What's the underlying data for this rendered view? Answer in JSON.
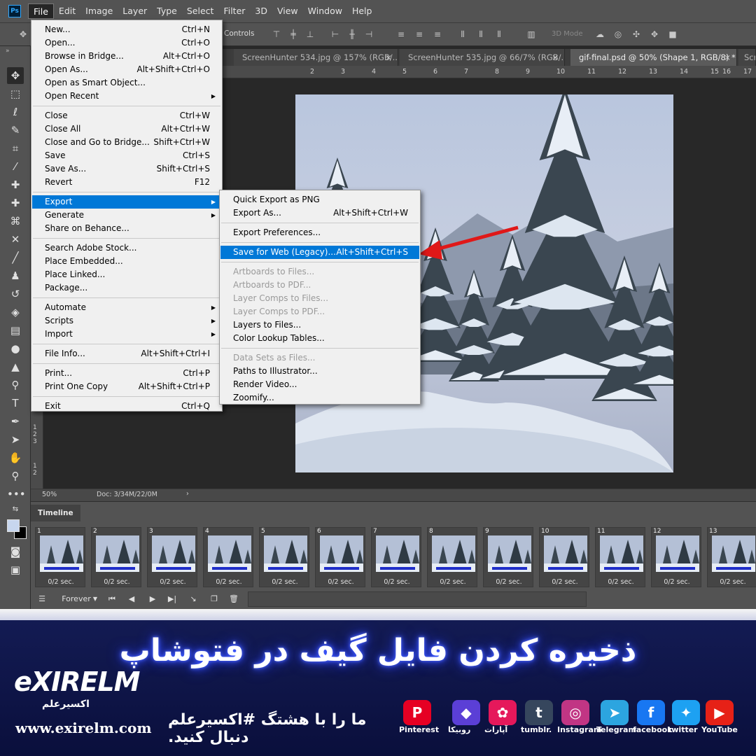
{
  "menubar": {
    "logo": "Ps",
    "items": [
      "File",
      "Edit",
      "Image",
      "Layer",
      "Type",
      "Select",
      "Filter",
      "3D",
      "View",
      "Window",
      "Help"
    ]
  },
  "options_bar": {
    "controls_label": "Controls",
    "mode3d_label": "3D Mode"
  },
  "tabs": [
    {
      "title": "ScreenHunter 534.jpg @ 157% (RGB/...",
      "close": "×"
    },
    {
      "title": "ScreenHunter 535.jpg @ 66/7% (RGB/...",
      "close": "×"
    },
    {
      "title": "gif-final.psd @ 50% (Shape 1, RGB/8) *",
      "close": "×"
    },
    {
      "title": "Scr",
      "close": ""
    }
  ],
  "ruler_top": [
    "2",
    "3",
    "4",
    "5",
    "6",
    "7",
    "8",
    "9",
    "10",
    "11",
    "12",
    "13",
    "14",
    "15",
    "16",
    "17"
  ],
  "ruler_left": [
    "1",
    "2",
    "3",
    "1",
    "2"
  ],
  "status": {
    "zoom": "50%",
    "doc": "Doc: 3/34M/22/0M"
  },
  "file_menu": {
    "groups": [
      [
        {
          "label": "New...",
          "shortcut": "Ctrl+N"
        },
        {
          "label": "Open...",
          "shortcut": "Ctrl+O"
        },
        {
          "label": "Browse in Bridge...",
          "shortcut": "Alt+Ctrl+O"
        },
        {
          "label": "Open As...",
          "shortcut": "Alt+Shift+Ctrl+O"
        },
        {
          "label": "Open as Smart Object...",
          "shortcut": ""
        },
        {
          "label": "Open Recent",
          "shortcut": "",
          "submenu": true
        }
      ],
      [
        {
          "label": "Close",
          "shortcut": "Ctrl+W"
        },
        {
          "label": "Close All",
          "shortcut": "Alt+Ctrl+W"
        },
        {
          "label": "Close and Go to Bridge...",
          "shortcut": "Shift+Ctrl+W"
        },
        {
          "label": "Save",
          "shortcut": "Ctrl+S"
        },
        {
          "label": "Save As...",
          "shortcut": "Shift+Ctrl+S"
        },
        {
          "label": "Revert",
          "shortcut": "F12"
        }
      ],
      [
        {
          "label": "Export",
          "shortcut": "",
          "submenu": true,
          "highlight": true
        },
        {
          "label": "Generate",
          "shortcut": "",
          "submenu": true
        },
        {
          "label": "Share on Behance...",
          "shortcut": ""
        }
      ],
      [
        {
          "label": "Search Adobe Stock...",
          "shortcut": ""
        },
        {
          "label": "Place Embedded...",
          "shortcut": ""
        },
        {
          "label": "Place Linked...",
          "shortcut": ""
        },
        {
          "label": "Package...",
          "shortcut": ""
        }
      ],
      [
        {
          "label": "Automate",
          "shortcut": "",
          "submenu": true
        },
        {
          "label": "Scripts",
          "shortcut": "",
          "submenu": true
        },
        {
          "label": "Import",
          "shortcut": "",
          "submenu": true
        }
      ],
      [
        {
          "label": "File Info...",
          "shortcut": "Alt+Shift+Ctrl+I"
        }
      ],
      [
        {
          "label": "Print...",
          "shortcut": "Ctrl+P"
        },
        {
          "label": "Print One Copy",
          "shortcut": "Alt+Shift+Ctrl+P"
        }
      ],
      [
        {
          "label": "Exit",
          "shortcut": "Ctrl+Q"
        }
      ]
    ]
  },
  "export_menu": {
    "groups": [
      [
        {
          "label": "Quick Export as PNG",
          "shortcut": ""
        },
        {
          "label": "Export As...",
          "shortcut": "Alt+Shift+Ctrl+W"
        }
      ],
      [
        {
          "label": "Export Preferences...",
          "shortcut": ""
        }
      ],
      [
        {
          "label": "Save for Web (Legacy)...",
          "shortcut": "Alt+Shift+Ctrl+S",
          "highlight": true
        }
      ],
      [
        {
          "label": "Artboards to Files...",
          "shortcut": "",
          "disabled": true
        },
        {
          "label": "Artboards to PDF...",
          "shortcut": "",
          "disabled": true
        },
        {
          "label": "Layer Comps to Files...",
          "shortcut": "",
          "disabled": true
        },
        {
          "label": "Layer Comps to PDF...",
          "shortcut": "",
          "disabled": true
        },
        {
          "label": "Layers to Files...",
          "shortcut": ""
        },
        {
          "label": "Color Lookup Tables...",
          "shortcut": ""
        }
      ],
      [
        {
          "label": "Data Sets as Files...",
          "shortcut": "",
          "disabled": true
        },
        {
          "label": "Paths to Illustrator...",
          "shortcut": ""
        },
        {
          "label": "Render Video...",
          "shortcut": ""
        },
        {
          "label": "Zoomify...",
          "shortcut": ""
        }
      ]
    ]
  },
  "timeline": {
    "tab": "Timeline",
    "frames": [
      {
        "n": "1",
        "d": "0/2 sec."
      },
      {
        "n": "2",
        "d": "0/2 sec."
      },
      {
        "n": "3",
        "d": "0/2 sec."
      },
      {
        "n": "4",
        "d": "0/2 sec."
      },
      {
        "n": "5",
        "d": "0/2 sec."
      },
      {
        "n": "6",
        "d": "0/2 sec."
      },
      {
        "n": "7",
        "d": "0/2 sec."
      },
      {
        "n": "8",
        "d": "0/2 sec."
      },
      {
        "n": "9",
        "d": "0/2 sec."
      },
      {
        "n": "10",
        "d": "0/2 sec."
      },
      {
        "n": "11",
        "d": "0/2 sec."
      },
      {
        "n": "12",
        "d": "0/2 sec."
      },
      {
        "n": "13",
        "d": "0/2 sec."
      }
    ],
    "loop": "Forever"
  },
  "banner": {
    "title": "ذخیره کردن فایل گیف در فتوشاپ",
    "logo": "eXIRELM",
    "logo_sub": "اکسیرعلم",
    "url": "www.exirelm.com",
    "tagline": "ما را با هشتگ #اکسیرعلم  دنبال کنید.",
    "socials": [
      {
        "name": "Pinterest",
        "glyph": "P",
        "color": "#e60023"
      },
      {
        "name": "روبیکا",
        "glyph": "◆",
        "color": "#5b3fd6"
      },
      {
        "name": "آپارات",
        "glyph": "✿",
        "color": "#e5185b"
      },
      {
        "name": "tumblr.",
        "glyph": "t",
        "color": "#36465d"
      },
      {
        "name": "Instagram",
        "glyph": "◎",
        "color": "#c13584"
      },
      {
        "name": "Telegram",
        "glyph": "➤",
        "color": "#2ca5e0"
      },
      {
        "name": "facebook",
        "glyph": "f",
        "color": "#1877f2"
      },
      {
        "name": "twitter",
        "glyph": "✦",
        "color": "#1da1f2"
      },
      {
        "name": "YouTube",
        "glyph": "▶",
        "color": "#e62117"
      }
    ]
  }
}
